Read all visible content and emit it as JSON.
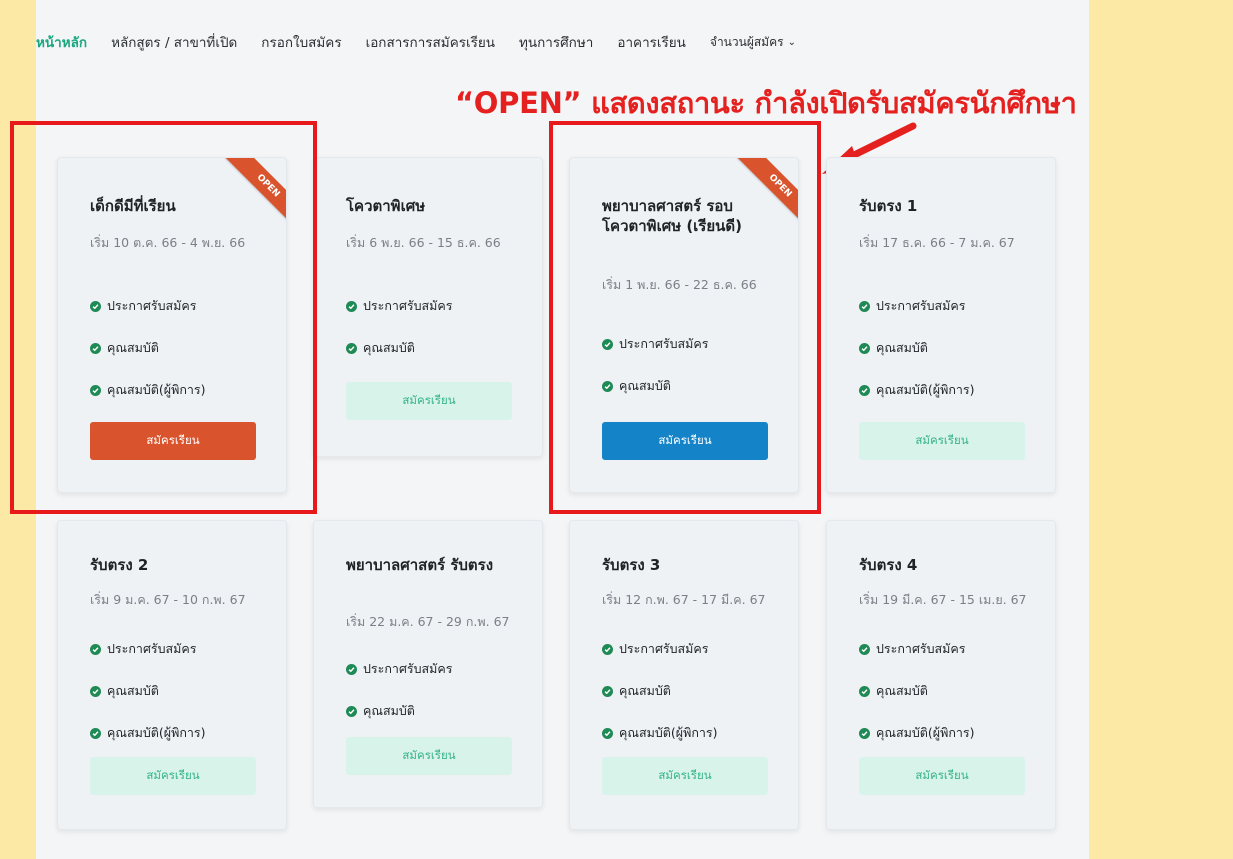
{
  "nav": {
    "items": [
      "หน้าหลัก",
      "หลักสูตร / สาขาที่เปิด",
      "กรอกใบสมัคร",
      "เอกสารการสมัครเรียน",
      "ทุนการศึกษา",
      "อาคารเรียน"
    ],
    "dropdown_label": "จำนวนผู้สมัคร",
    "dropdown_icon": "chevron-down-icon"
  },
  "annotation": {
    "headline": "“OPEN” แสดงสถานะ กำลังเปิดรับสมัครนักศึกษา"
  },
  "ribbon_label": "OPEN",
  "colors": {
    "accent_green": "#1aa77f",
    "apply_red": "#d9532d",
    "apply_blue": "#1483c7",
    "highlight_red": "#e8191a",
    "background": "#fde9a6"
  },
  "cards": [
    {
      "title": "เด็กดีมีที่เรียน",
      "date": "เริ่ม 10 ต.ค. 66 - 4 พ.ย. 66",
      "features": [
        "ประกาศรับสมัคร",
        "คุณสมบัติ",
        "คุณสมบัติ(ผู้พิการ)"
      ],
      "button": "สมัครเรียน",
      "open": true
    },
    {
      "title": "โควตาพิเศษ",
      "date": "เริ่ม 6 พ.ย. 66 - 15 ธ.ค. 66",
      "features": [
        "ประกาศรับสมัคร",
        "คุณสมบัติ"
      ],
      "button": "สมัครเรียน",
      "open": false
    },
    {
      "title": "พยาบาลศาสตร์ รอบโควตาพิเศษ (เรียนดี)",
      "date": "เริ่ม 1 พ.ย. 66 - 22 ธ.ค. 66",
      "features": [
        "ประกาศรับสมัคร",
        "คุณสมบัติ"
      ],
      "button": "สมัครเรียน",
      "open": true
    },
    {
      "title": "รับตรง 1",
      "date": "เริ่ม 17 ธ.ค. 66 - 7 ม.ค. 67",
      "features": [
        "ประกาศรับสมัคร",
        "คุณสมบัติ",
        "คุณสมบัติ(ผู้พิการ)"
      ],
      "button": "สมัครเรียน",
      "open": false
    },
    {
      "title": "รับตรง 2",
      "date": "เริ่ม 9 ม.ค. 67 - 10 ก.พ. 67",
      "features": [
        "ประกาศรับสมัคร",
        "คุณสมบัติ",
        "คุณสมบัติ(ผู้พิการ)"
      ],
      "button": "สมัครเรียน",
      "open": false
    },
    {
      "title": "พยาบาลศาสตร์ รับตรง",
      "date": "เริ่ม 22 ม.ค. 67 - 29 ก.พ. 67",
      "features": [
        "ประกาศรับสมัคร",
        "คุณสมบัติ"
      ],
      "button": "สมัครเรียน",
      "open": false
    },
    {
      "title": "รับตรง 3",
      "date": "เริ่ม 12 ก.พ. 67 - 17 มี.ค. 67",
      "features": [
        "ประกาศรับสมัคร",
        "คุณสมบัติ",
        "คุณสมบัติ(ผู้พิการ)"
      ],
      "button": "สมัครเรียน",
      "open": false
    },
    {
      "title": "รับตรง 4",
      "date": "เริ่ม 19 มี.ค. 67 - 15 เม.ย. 67",
      "features": [
        "ประกาศรับสมัคร",
        "คุณสมบัติ",
        "คุณสมบัติ(ผู้พิการ)"
      ],
      "button": "สมัครเรียน",
      "open": false
    }
  ]
}
